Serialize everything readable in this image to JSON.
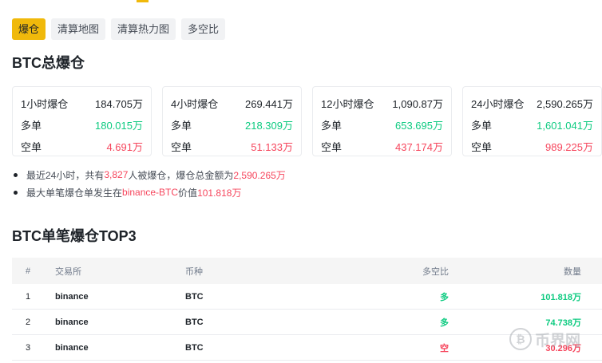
{
  "tabs": [
    "爆仓",
    "清算地图",
    "清算热力图",
    "多空比"
  ],
  "section1_title": "BTC总爆仓",
  "cards": [
    {
      "period_label": "1小时爆仓",
      "total": "184.705万",
      "long_label": "多单",
      "long": "180.015万",
      "short_label": "空单",
      "short": "4.691万"
    },
    {
      "period_label": "4小时爆仓",
      "total": "269.441万",
      "long_label": "多单",
      "long": "218.309万",
      "short_label": "空单",
      "short": "51.133万"
    },
    {
      "period_label": "12小时爆仓",
      "total": "1,090.87万",
      "long_label": "多单",
      "long": "653.695万",
      "short_label": "空单",
      "short": "437.174万"
    },
    {
      "period_label": "24小时爆仓",
      "total": "2,590.265万",
      "long_label": "多单",
      "long": "1,601.041万",
      "short_label": "空单",
      "short": "989.225万"
    }
  ],
  "notes": {
    "line1": {
      "pre": "最近24小时，共有",
      "count": "3,827",
      "mid": "人被爆仓，爆仓总金额为",
      "amount": "2,590.265万"
    },
    "line2": {
      "pre": "最大单笔爆仓单发生在",
      "exchange": "binance-BTC",
      "mid": "价值",
      "amount": "101.818万"
    }
  },
  "section2_title": "BTC单笔爆仓TOP3",
  "table": {
    "headers": [
      "#",
      "交易所",
      "币种",
      "多空比",
      "数量"
    ],
    "rows": [
      {
        "idx": "1",
        "exchange": "binance",
        "coin": "BTC",
        "side": "多",
        "amount": "101.818万"
      },
      {
        "idx": "2",
        "exchange": "binance",
        "coin": "BTC",
        "side": "多",
        "amount": "74.738万"
      },
      {
        "idx": "3",
        "exchange": "binance",
        "coin": "BTC",
        "side": "空",
        "amount": "30.296万"
      }
    ]
  },
  "watermark": {
    "text": "币界网"
  },
  "colors": {
    "accent": "#f0b90b",
    "long": "#0ecb81",
    "short": "#f6465d"
  }
}
